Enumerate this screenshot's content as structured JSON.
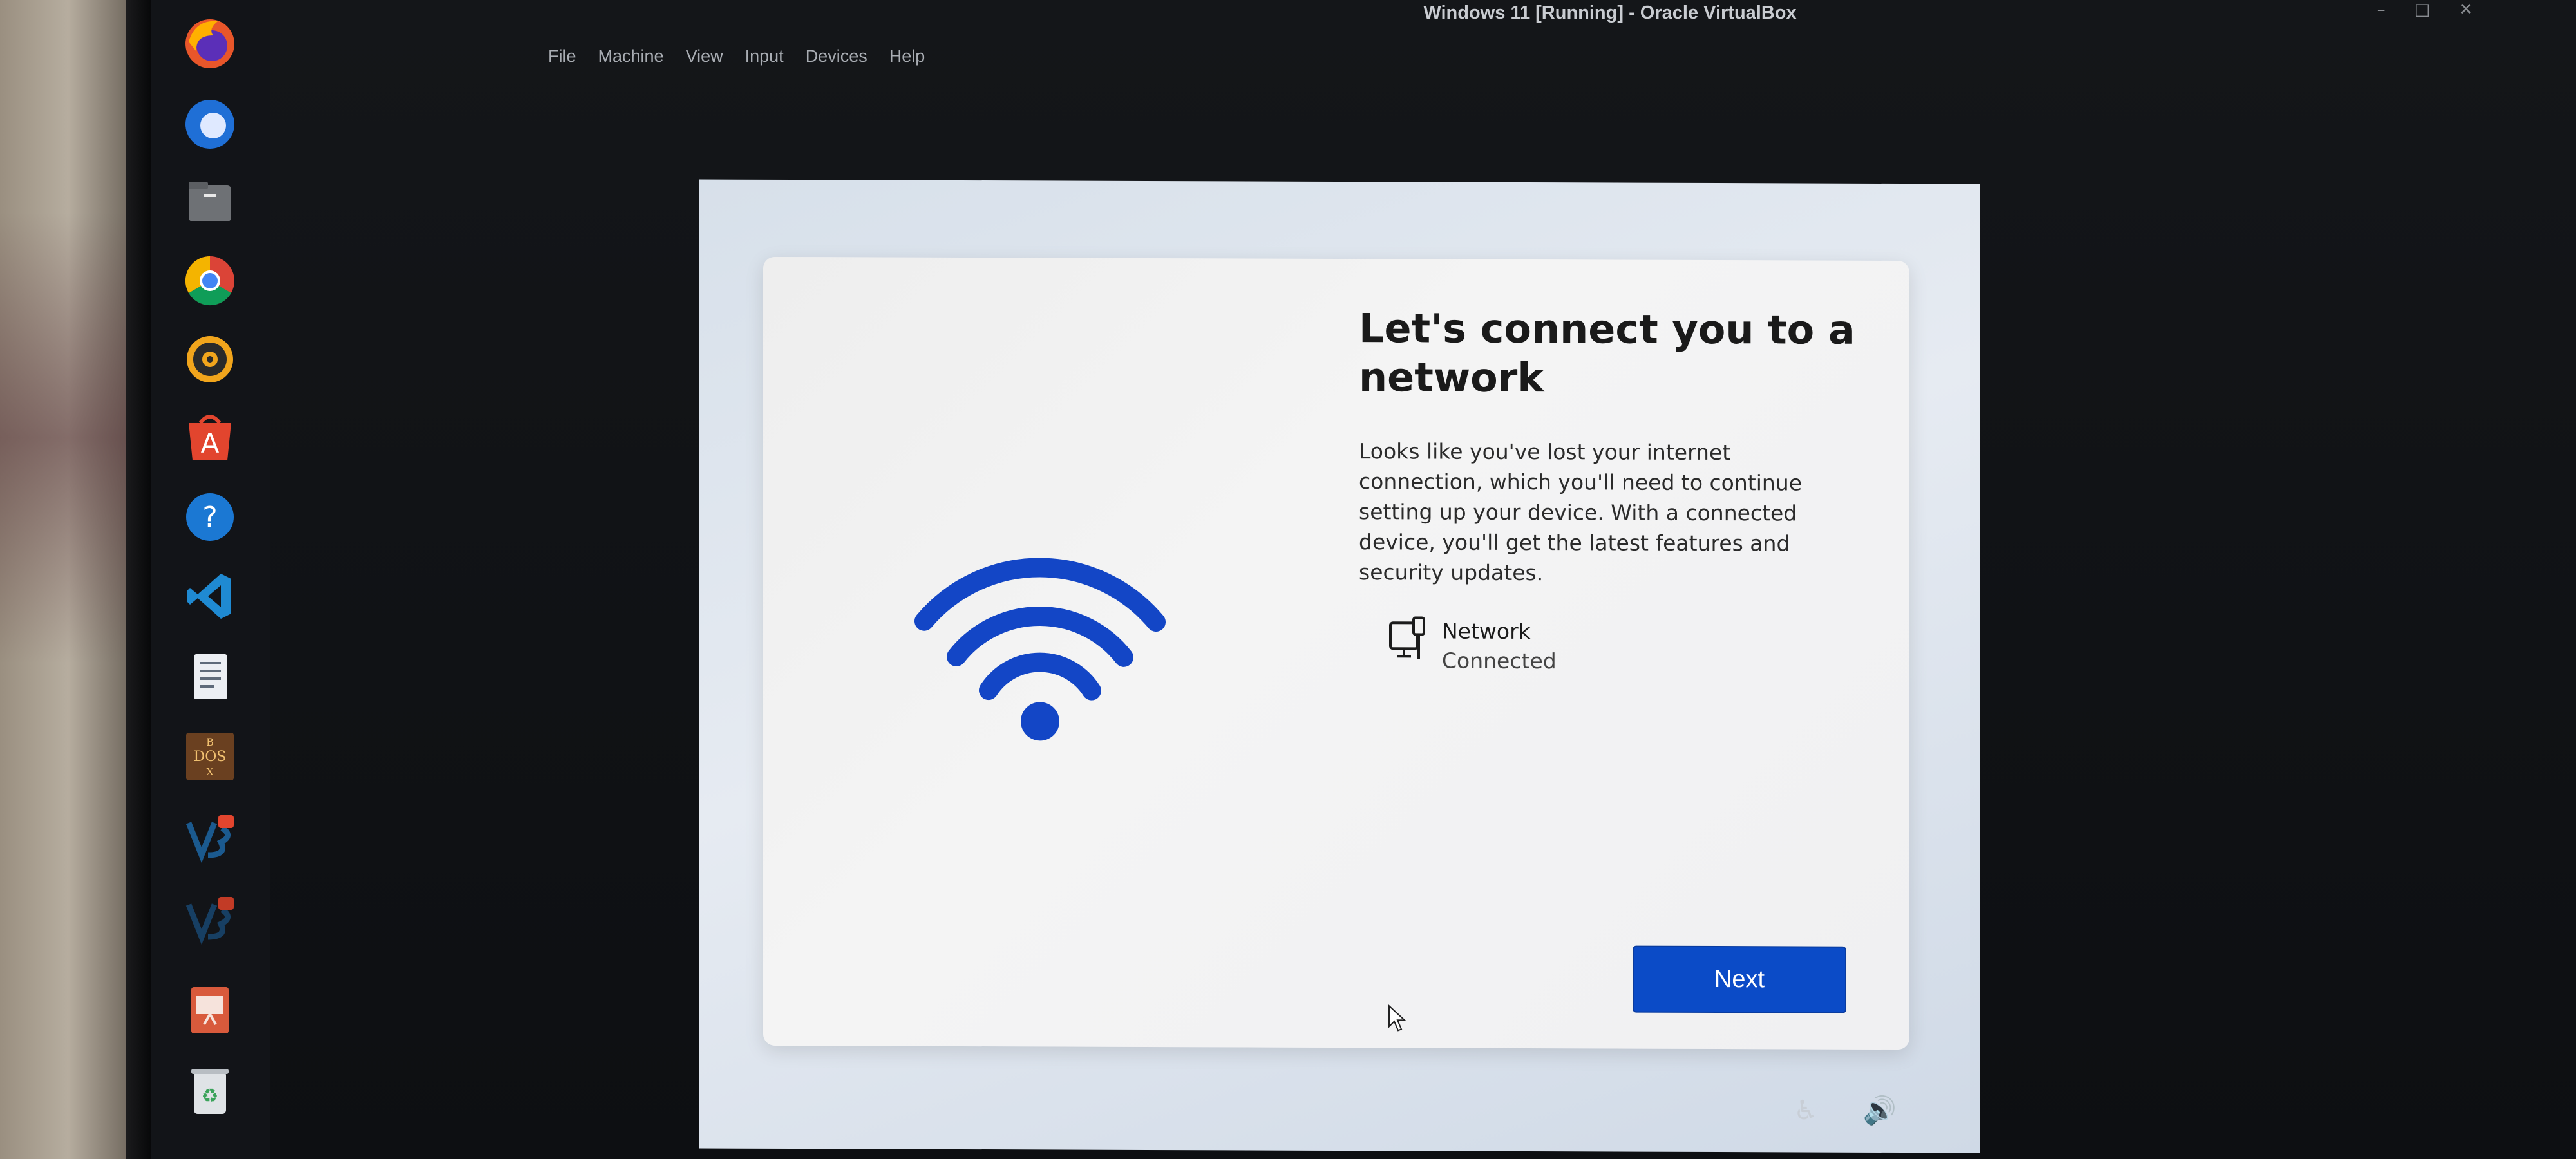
{
  "window": {
    "title": "Windows 11 [Running] - Oracle VirtualBox",
    "controls": [
      "–",
      "□",
      "✕"
    ]
  },
  "menubar": [
    "File",
    "Machine",
    "View",
    "Input",
    "Devices",
    "Help"
  ],
  "dock": [
    {
      "name": "firefox-icon"
    },
    {
      "name": "thunderbird-icon"
    },
    {
      "name": "files-icon"
    },
    {
      "name": "chrome-icon"
    },
    {
      "name": "rhythmbox-icon"
    },
    {
      "name": "app-center-icon",
      "glyph": "A"
    },
    {
      "name": "help-icon",
      "glyph": "?"
    },
    {
      "name": "vscode-icon"
    },
    {
      "name": "text-editor-icon"
    },
    {
      "name": "dosbox-icon",
      "glyph": "B D O S X"
    },
    {
      "name": "virtualbox-icon"
    },
    {
      "name": "virtualbox-2-icon"
    },
    {
      "name": "presentation-icon"
    },
    {
      "name": "trash-icon",
      "glyph": "♻"
    }
  ],
  "oobe": {
    "heading": "Let's connect you to a network",
    "description": "Looks like you've lost your internet connection, which you'll need to continue setting up your device. With a connected device, you'll get the latest features and security updates.",
    "network_label": "Network",
    "network_status": "Connected",
    "next_label": "Next"
  },
  "colors": {
    "accent": "#0b4bc7",
    "wifi": "#1346c6"
  },
  "bottom_icons": [
    "accessibility-icon",
    "volume-icon"
  ]
}
